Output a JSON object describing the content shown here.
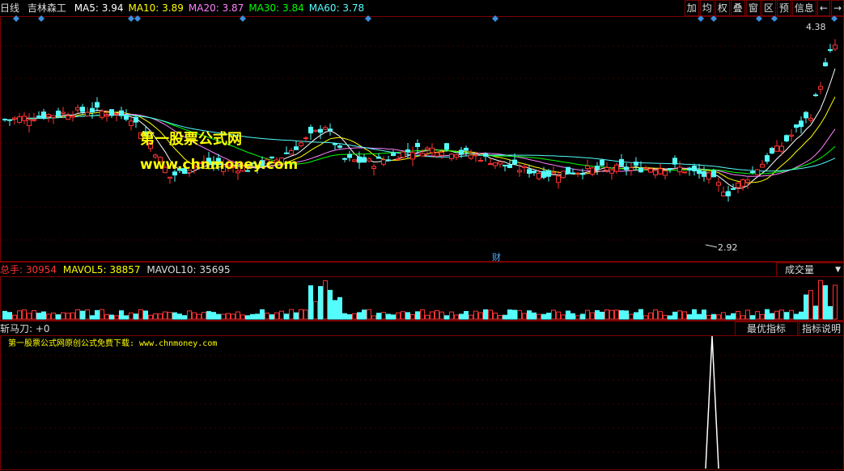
{
  "header": {
    "period": "日线",
    "stock": "吉林森工",
    "ma": [
      {
        "label": "MA5:",
        "value": "3.94",
        "color": "#ffffff"
      },
      {
        "label": "MA10:",
        "value": "3.89",
        "color": "#ffff00"
      },
      {
        "label": "MA20:",
        "value": "3.87",
        "color": "#ff80ff"
      },
      {
        "label": "MA30:",
        "value": "3.84",
        "color": "#00ff00"
      },
      {
        "label": "MA60:",
        "value": "3.78",
        "color": "#54fcfc"
      }
    ],
    "buttons": [
      "加",
      "均",
      "权",
      "叠",
      "窗",
      "区",
      "预",
      "信息"
    ],
    "arrows": [
      "←",
      "→"
    ]
  },
  "price_panel": {
    "high_label": "4.38",
    "low_label": "2.92",
    "event_label": "财",
    "watermark_title": "第一股票公式网",
    "watermark_url": "www.chnmoney.com"
  },
  "volume_panel": {
    "total_label": "总手:",
    "total_value": "30954",
    "mavol5_label": "MAVOL5:",
    "mavol5_value": "38857",
    "mavol10_label": "MAVOL10:",
    "mavol10_value": "35695",
    "dropdown": "成交量"
  },
  "indicator_panel": {
    "name": "斩马刀:",
    "value": "+0",
    "btn_best": "最优指标",
    "btn_help": "指标说明",
    "note": "第一股票公式网原创公式免费下载: www.chnmoney.com"
  },
  "colors": {
    "up": "#ff3232",
    "down": "#54fcfc",
    "frame": "#7a0000",
    "diamond": "#3a8fe0"
  }
}
